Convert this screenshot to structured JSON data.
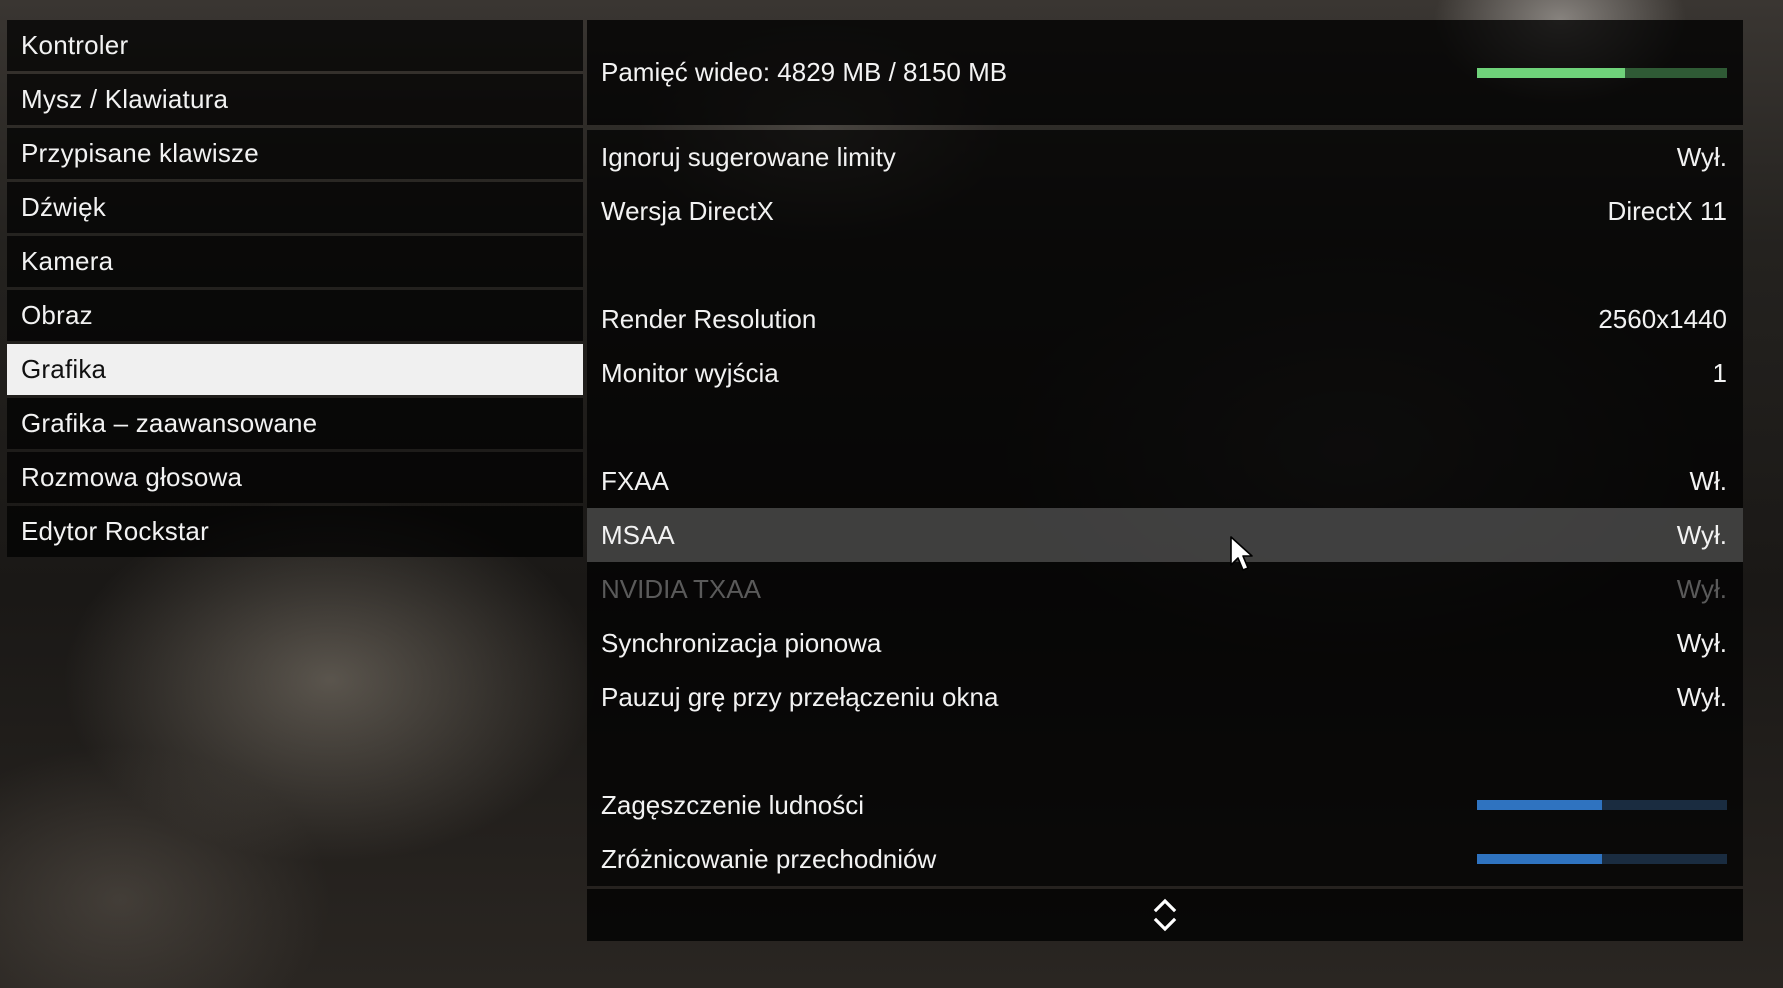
{
  "nav": {
    "items": [
      {
        "label": "Kontroler",
        "active": false
      },
      {
        "label": "Mysz / Klawiatura",
        "active": false
      },
      {
        "label": "Przypisane klawisze",
        "active": false
      },
      {
        "label": "Dźwięk",
        "active": false
      },
      {
        "label": "Kamera",
        "active": false
      },
      {
        "label": "Obraz",
        "active": false
      },
      {
        "label": "Grafika",
        "active": true
      },
      {
        "label": "Grafika – zaawansowane",
        "active": false
      },
      {
        "label": "Rozmowa głosowa",
        "active": false
      },
      {
        "label": "Edytor Rockstar",
        "active": false
      }
    ]
  },
  "vram": {
    "label": "Pamięć wideo: 4829 MB / 8150 MB",
    "used_fraction": 0.59,
    "fill_color": "#6fd27a",
    "track_color": "#2f5a35"
  },
  "settings": {
    "rows": [
      {
        "label": "Ignoruj sugerowane limity",
        "value": "Wył."
      },
      {
        "label": "Wersja DirectX",
        "value": "DirectX 11"
      },
      {
        "label": "Render Resolution",
        "value": "2560x1440"
      },
      {
        "label": "Monitor wyjścia",
        "value": "1"
      },
      {
        "label": "FXAA",
        "value": "Wł."
      },
      {
        "label": "MSAA",
        "value": "Wył."
      },
      {
        "label": "NVIDIA TXAA",
        "value": "Wył."
      },
      {
        "label": "Synchronizacja pionowa",
        "value": "Wył."
      },
      {
        "label": "Pauzuj grę przy przełączeniu okna",
        "value": "Wył."
      },
      {
        "label": "Zagęszczenie ludności",
        "level": 0.5
      },
      {
        "label": "Zróżnicowanie przechodniów",
        "level": 0.5
      }
    ],
    "slider_fill_color": "#2f73c0",
    "slider_track_color": "#1a2c40"
  },
  "icons": {
    "scroll": "up-down-chevron-icon",
    "cursor": "mouse-pointer-icon"
  }
}
